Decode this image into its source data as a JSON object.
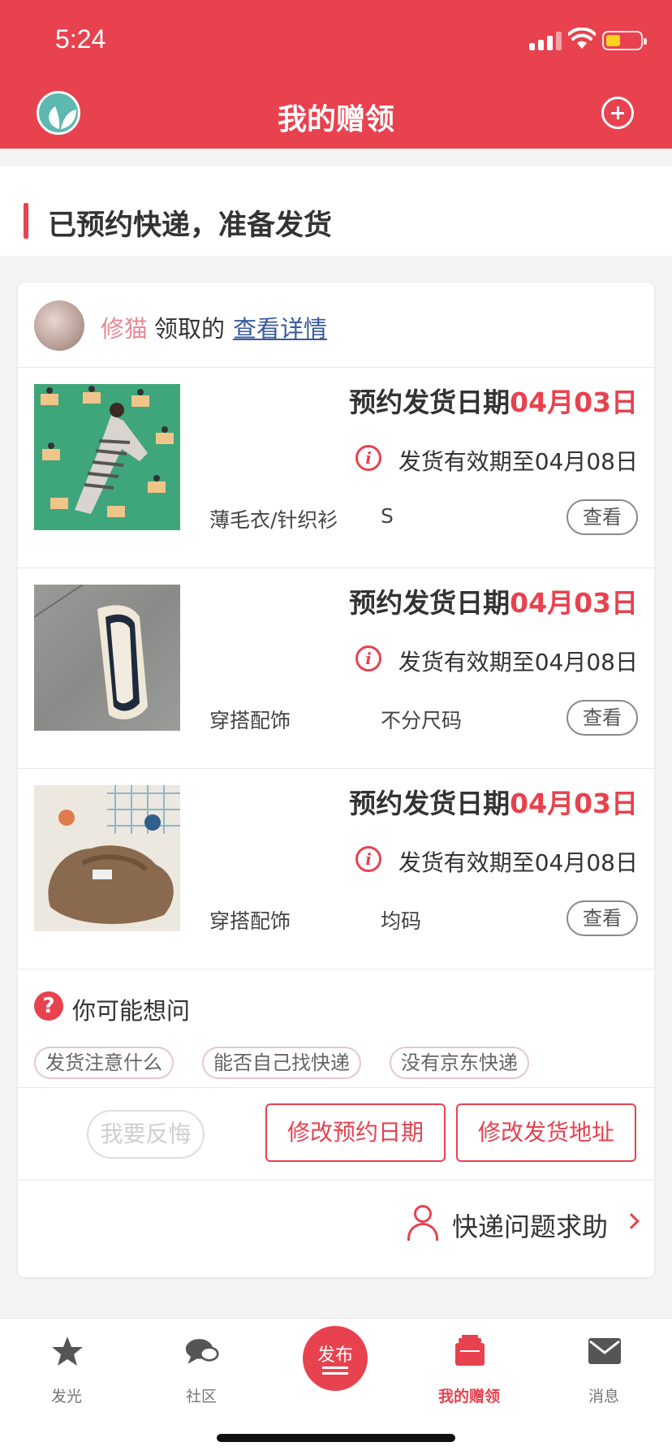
{
  "status": {
    "time": "5:24"
  },
  "nav": {
    "title": "我的赠领"
  },
  "section": {
    "title": "已预约快递，准备发货"
  },
  "claimer": {
    "name": "修猫",
    "mid": "领取的",
    "link": "查看详情"
  },
  "items": [
    {
      "ship_label": "预约发货日期",
      "ship_date": "04月03日",
      "valid": "发货有效期至04月08日",
      "category": "薄毛衣/针织衫",
      "size": "S",
      "view": "查看"
    },
    {
      "ship_label": "预约发货日期",
      "ship_date": "04月03日",
      "valid": "发货有效期至04月08日",
      "category": "穿搭配饰",
      "size": "不分尺码",
      "view": "查看"
    },
    {
      "ship_label": "预约发货日期",
      "ship_date": "04月03日",
      "valid": "发货有效期至04月08日",
      "category": "穿搭配饰",
      "size": "均码",
      "view": "查看"
    }
  ],
  "faq": {
    "title": "你可能想问",
    "chips": [
      "发货注意什么",
      "能否自己找快递",
      "没有京东快递"
    ]
  },
  "actions": {
    "regret": "我要反悔",
    "change_date": "修改预约日期",
    "change_address": "修改发货地址"
  },
  "help": {
    "label": "快递问题求助"
  },
  "tabs": [
    {
      "label": "发光",
      "icon": "star-icon"
    },
    {
      "label": "社区",
      "icon": "chat-bubbles-icon"
    },
    {
      "label": "发布",
      "icon": "publish-icon"
    },
    {
      "label": "我的赠领",
      "icon": "gift-box-icon",
      "active": true
    },
    {
      "label": "消息",
      "icon": "envelope-icon"
    }
  ],
  "colors": {
    "brand_red": "#e8424f",
    "link_blue": "#3a5a9c"
  }
}
